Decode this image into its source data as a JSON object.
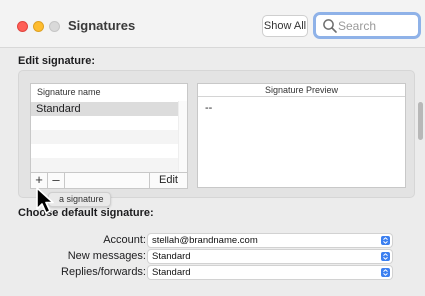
{
  "window": {
    "title": "Signatures",
    "show_all_label": "Show All",
    "search_placeholder": "Search"
  },
  "edit_section": {
    "label": "Edit signature:",
    "list_header": "Signature name",
    "signatures": [
      "Standard"
    ],
    "selected_index": 0,
    "add_label": "+",
    "remove_label": "–",
    "edit_label": "Edit",
    "preview_header": "Signature Preview",
    "preview_text": "--",
    "tooltip": "a signature"
  },
  "default_section": {
    "label": "Choose default signature:",
    "rows": [
      {
        "label": "Account:",
        "value": "stellah@brandname.com"
      },
      {
        "label": "New messages:",
        "value": "Standard"
      },
      {
        "label": "Replies/forwards:",
        "value": "Standard"
      }
    ]
  },
  "colors": {
    "accent": "#3b7ff0",
    "search_focus": "#8fb2e8",
    "close": "#ff5f57",
    "minimize": "#febc2e"
  }
}
